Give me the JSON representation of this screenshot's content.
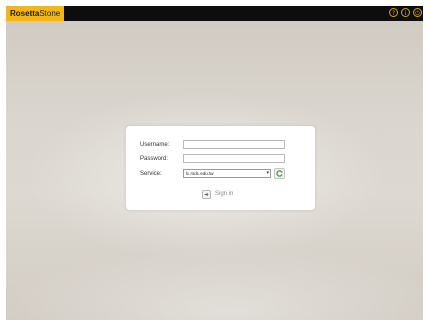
{
  "app": {
    "logo_part1": "Rosetta",
    "logo_part2": "Stone"
  },
  "topbar_icons": [
    "help-icon",
    "info-icon",
    "power-icon"
  ],
  "login": {
    "username_label": "Username:",
    "username_value": "",
    "password_label": "Password:",
    "password_value": "",
    "service_label": "Service:",
    "service_value": "lc.rsdc.edu.tw",
    "signin_label": "Sign in"
  },
  "colors": {
    "accent": "#f2b619",
    "topbar": "#0d0d0d",
    "refresh_green": "#3aa648"
  }
}
